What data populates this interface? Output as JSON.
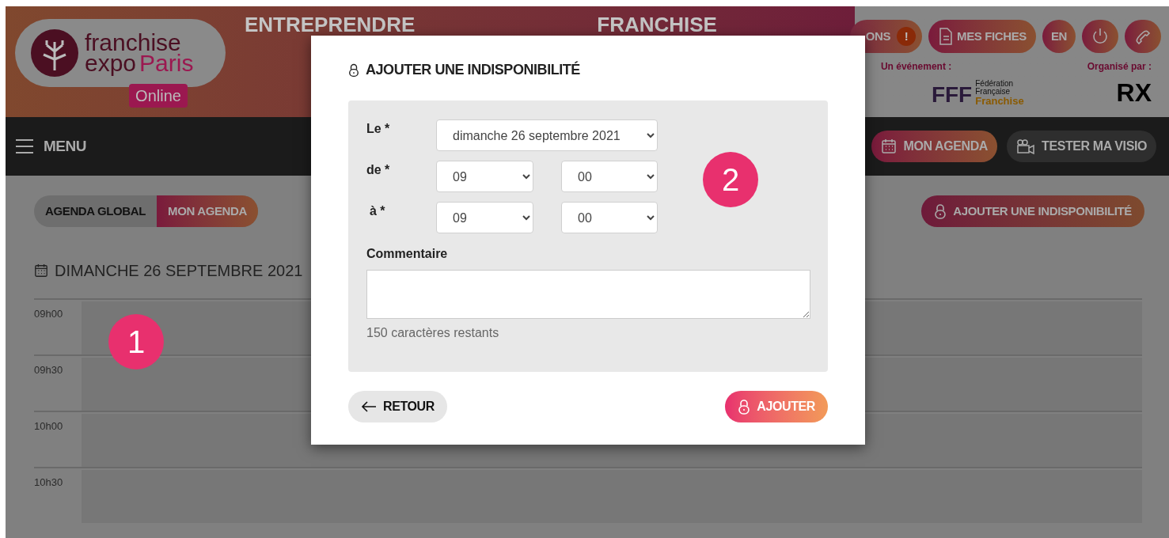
{
  "header": {
    "logo": {
      "line_1": "franchise",
      "line_2a": "expo",
      "line_2b": "Paris",
      "tag": "Online"
    },
    "taglines": [
      "ENTREPRENDRE",
      "FRANCHISE"
    ],
    "alerts_button": {
      "label": "ONS",
      "badge": "!"
    },
    "sheets_button": {
      "label": "MES FICHES"
    },
    "language_button": {
      "label": "EN"
    },
    "event_label": "Un événement :",
    "event_logo": {
      "mark": "FFF",
      "line_1": "Fédération",
      "line_2": "Française",
      "line_3": "Franchise"
    },
    "organizer_label": "Organisé par :",
    "organizer_logo": "RX"
  },
  "nav": {
    "menu": "MENU",
    "agenda": "MON AGENDA",
    "visio": "TESTER MA VISIO"
  },
  "toggle": [
    {
      "label": "AGENDA GLOBAL",
      "selected": false
    },
    {
      "label": "MON AGENDA",
      "selected": true
    }
  ],
  "add_button": "AJOUTER UNE INDISPONIBILITÉ",
  "day_title": "DIMANCHE 26 SEPTEMBRE 2021",
  "slots": [
    "09h00",
    "09h30",
    "10h00",
    "10h30"
  ],
  "callouts": [
    "1",
    "2"
  ],
  "modal": {
    "title": "AJOUTER UNE INDISPONIBILITÉ",
    "date_label": "Le *",
    "date_value": "dimanche 26 septembre 2021",
    "from_label": "de *",
    "from_hour": "09",
    "from_minute": "00",
    "to_label": "à *",
    "to_hour": "09",
    "to_minute": "00",
    "comment_label": "Commentaire",
    "counter": "150 caractères restants",
    "back": "RETOUR",
    "submit": "AJOUTER"
  }
}
